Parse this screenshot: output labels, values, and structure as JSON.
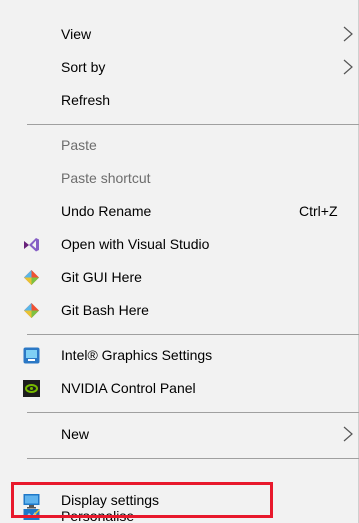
{
  "menu": {
    "view": {
      "label": "View",
      "icon": "chevron-right-icon"
    },
    "sort_by": {
      "label": "Sort by",
      "icon": "chevron-right-icon"
    },
    "refresh": {
      "label": "Refresh"
    },
    "paste": {
      "label": "Paste",
      "disabled": true
    },
    "paste_shortcut": {
      "label": "Paste shortcut",
      "disabled": true
    },
    "undo_rename": {
      "label": "Undo Rename",
      "shortcut": "Ctrl+Z"
    },
    "open_vs": {
      "label": "Open with Visual Studio",
      "icon": "visual-studio-icon"
    },
    "git_gui": {
      "label": "Git GUI Here",
      "icon": "git-icon"
    },
    "git_bash": {
      "label": "Git Bash Here",
      "icon": "git-icon"
    },
    "intel": {
      "label": "Intel® Graphics Settings",
      "icon": "intel-graphics-icon"
    },
    "nvidia": {
      "label": "NVIDIA Control Panel",
      "icon": "nvidia-icon"
    },
    "new": {
      "label": "New",
      "icon": "chevron-right-icon"
    },
    "display": {
      "label": "Display settings",
      "icon": "monitor-icon"
    },
    "personalise": {
      "label": "Personalise",
      "icon": "personalise-icon"
    }
  },
  "colors": {
    "menu_background": "#f2f2f2",
    "separator": "#a0a0a0",
    "disabled_text": "#6d6d6d",
    "highlight_border": "#e8192c"
  }
}
